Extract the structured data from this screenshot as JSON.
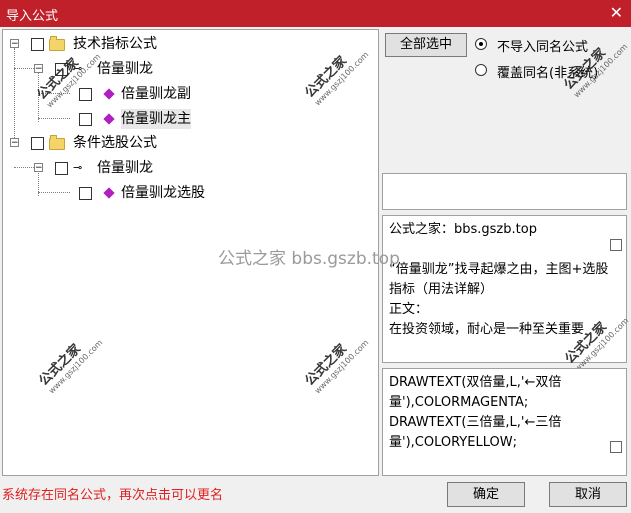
{
  "window": {
    "title": "导入公式",
    "close_glyph": "✕"
  },
  "tree": {
    "nodes": [
      {
        "label": "技术指标公式",
        "expander": "−"
      },
      {
        "label": "倍量驯龙",
        "expander": "−"
      },
      {
        "label": "倍量驯龙副"
      },
      {
        "label": "倍量驯龙主"
      },
      {
        "label": "条件选股公式",
        "expander": "−"
      },
      {
        "label": "倍量驯龙",
        "expander": "−"
      },
      {
        "label": "倍量驯龙选股"
      }
    ],
    "key_glyph": "⊸"
  },
  "options": {
    "select_all_label": "全部选中",
    "radio_no_import": "不导入同名公式",
    "radio_overwrite": "覆盖同名(非系统)",
    "selected": "no_import"
  },
  "description_panel": {
    "text": "公式之家：bbs.gszb.top\n\n“倍量驯龙”找寻起爆之由，主图+选股指标（用法详解）\n正文：\n在投资领域，耐心是一种至关重要"
  },
  "code_panel": {
    "text": "DRAWTEXT(双倍量,L,'←双倍量'),COLORMAGENTA;\nDRAWTEXT(三倍量,L,'←三倍量'),COLORYELLOW;"
  },
  "watermark": {
    "brand": "公式之家",
    "url": "www.gszj100.com",
    "center": "公式之家 bbs.gszb.top"
  },
  "status_text": "系统存在同名公式，再次点击可以更名",
  "buttons": {
    "ok": "确定",
    "cancel": "取消"
  }
}
